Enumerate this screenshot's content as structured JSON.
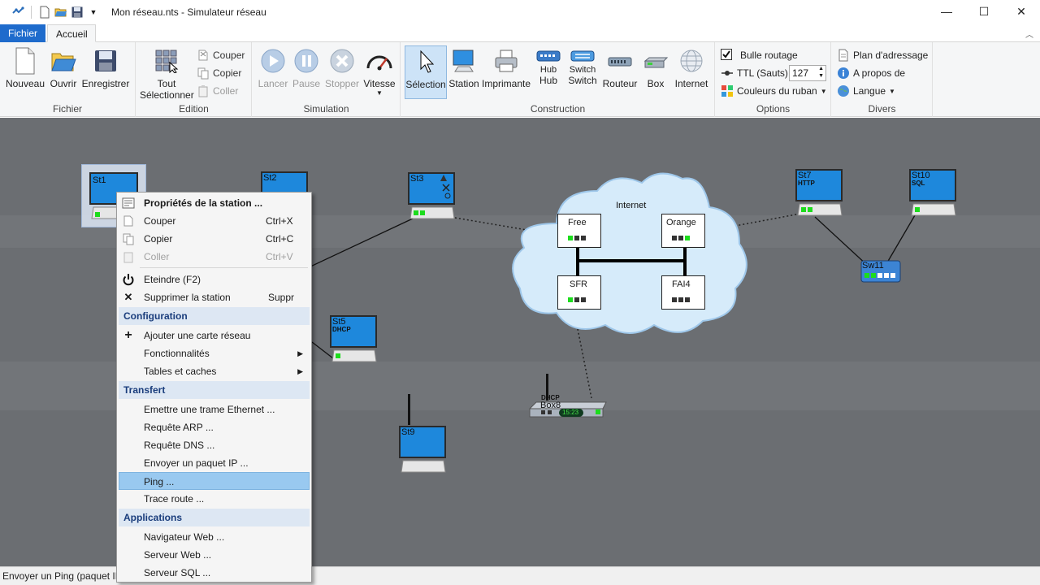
{
  "window": {
    "title": "Mon réseau.nts - Simulateur réseau",
    "minimize": "—",
    "maximize": "☐",
    "close": "✕"
  },
  "tabs": {
    "file": "Fichier",
    "home": "Accueil"
  },
  "ribbon": {
    "fichier": {
      "label": "Fichier",
      "new": "Nouveau",
      "open": "Ouvrir",
      "save": "Enregistrer"
    },
    "edition": {
      "label": "Edition",
      "select_all_1": "Tout",
      "select_all_2": "Sélectionner",
      "cut": "Couper",
      "copy": "Copier",
      "paste": "Coller"
    },
    "simulation": {
      "label": "Simulation",
      "start": "Lancer",
      "pause": "Pause",
      "stop": "Stopper",
      "speed": "Vitesse"
    },
    "construction": {
      "label": "Construction",
      "selection": "Sélection",
      "station": "Station",
      "printer": "Imprimante",
      "hub_top": "Hub",
      "hub": "Hub",
      "switch_top": "Switch",
      "switch": "Switch",
      "router": "Routeur",
      "box": "Box",
      "internet": "Internet"
    },
    "options": {
      "label": "Options",
      "bubble": "Bulle routage",
      "ttl": "TTL (Sauts)",
      "ttl_value": "127",
      "ribbon_colors": "Couleurs du ruban"
    },
    "divers": {
      "label": "Divers",
      "addressing": "Plan d'adressage",
      "about": "A propos de",
      "language": "Langue"
    }
  },
  "canvas": {
    "stations": [
      {
        "name": "St1",
        "service": ""
      },
      {
        "name": "St2",
        "service": ""
      },
      {
        "name": "St3",
        "service": ""
      },
      {
        "name": "St5",
        "service": "DHCP"
      },
      {
        "name": "St7",
        "service": "HTTP"
      },
      {
        "name": "St9",
        "service": ""
      },
      {
        "name": "St10",
        "service": "SQL"
      }
    ],
    "switch_name": "Sw11",
    "box": {
      "name": "Box8",
      "service": "DHCP",
      "display": "15:23"
    },
    "internet": {
      "label": "Internet",
      "isps": [
        "Free",
        "Orange",
        "SFR",
        "FAI4"
      ]
    }
  },
  "status": "Envoyer un Ping (paquet IP",
  "context_menu": {
    "properties": "Propriétés de la station ...",
    "cut": "Couper",
    "cut_key": "Ctrl+X",
    "copy": "Copier",
    "copy_key": "Ctrl+C",
    "paste": "Coller",
    "paste_key": "Ctrl+V",
    "power_off": "Eteindre  (F2)",
    "delete": "Supprimer la station",
    "delete_key": "Suppr",
    "section_config": "Configuration",
    "add_card": "Ajouter une carte réseau",
    "features": "Fonctionnalités",
    "tables": "Tables et caches",
    "section_transfer": "Transfert",
    "eth_frame": "Emettre une trame Ethernet ...",
    "arp": "Requête ARP ...",
    "dns": "Requête DNS ...",
    "ip_packet": "Envoyer un paquet IP ...",
    "ping": "Ping ...",
    "traceroute": "Trace route ...",
    "section_apps": "Applications",
    "browser": "Navigateur Web ...",
    "web_server": "Serveur Web ...",
    "sql_server": "Serveur SQL ..."
  }
}
